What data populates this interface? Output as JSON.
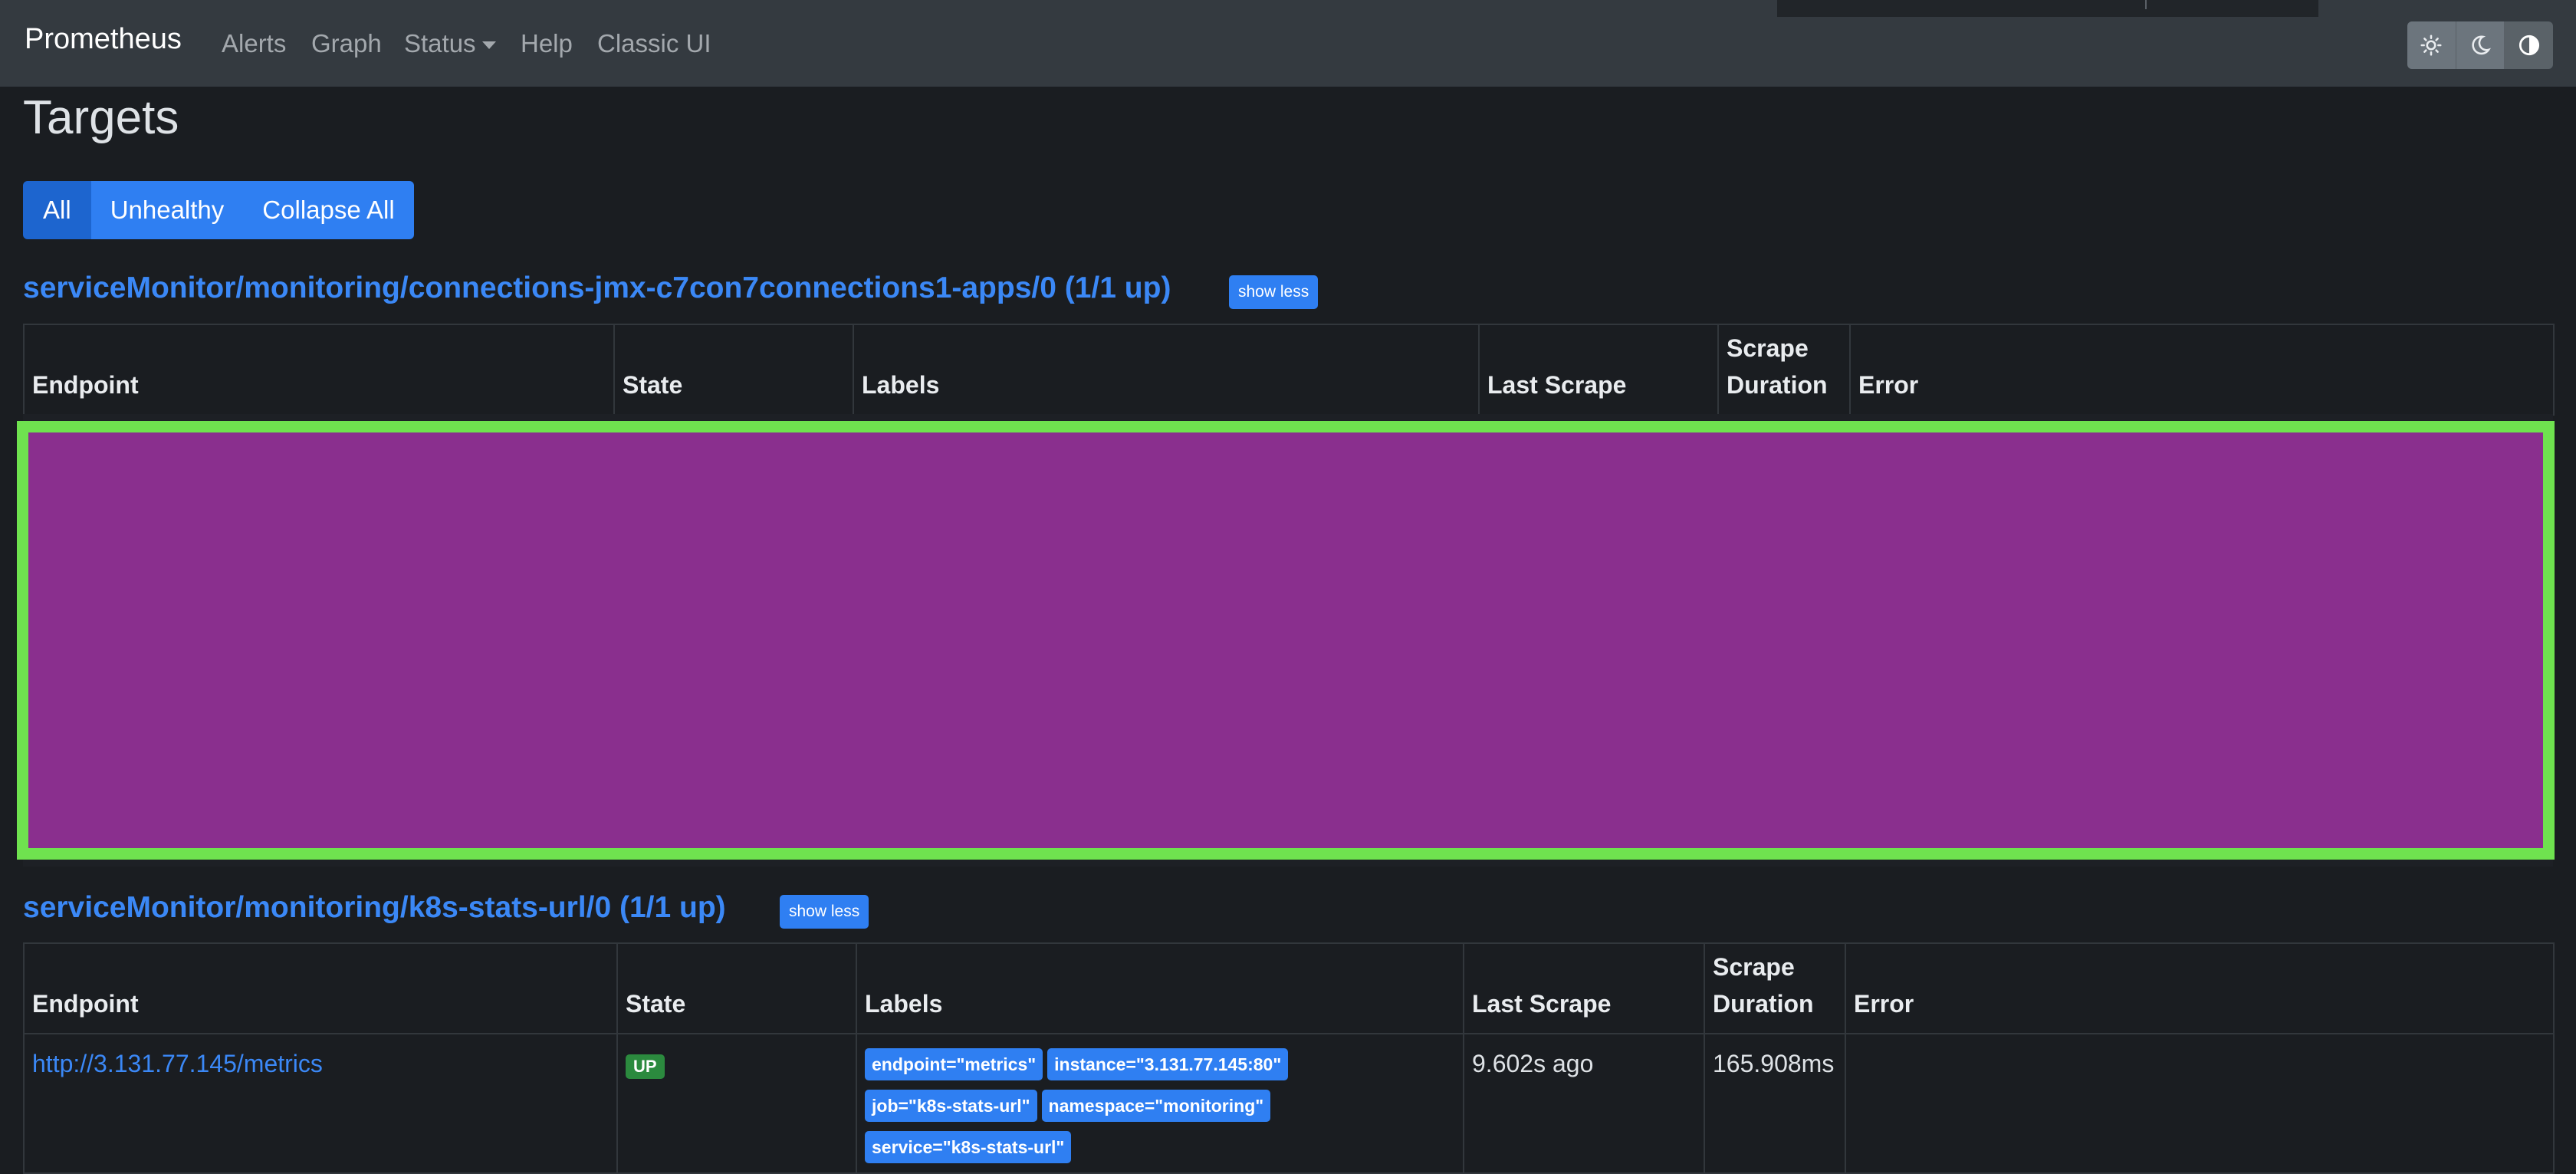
{
  "navbar": {
    "brand": "Prometheus",
    "links": [
      "Alerts",
      "Graph",
      "Status",
      "Help",
      "Classic UI"
    ],
    "theme_icons": [
      "sun-icon",
      "moon-icon",
      "contrast-icon"
    ]
  },
  "page": {
    "title": "Targets",
    "filters": [
      "All",
      "Unhealthy",
      "Collapse All"
    ]
  },
  "table_headers": [
    "Endpoint",
    "State",
    "Labels",
    "Last Scrape",
    "Scrape Duration",
    "Error"
  ],
  "pools": [
    {
      "title": "serviceMonitor/monitoring/connections-jmx-c7con7connections1-apps/0 (1/1 up)",
      "toggle": "show less"
    },
    {
      "title": "serviceMonitor/monitoring/k8s-stats-url/0 (1/1 up)",
      "toggle": "show less",
      "rows": [
        {
          "endpoint": "http://3.131.77.145/metrics",
          "state": "UP",
          "labels": [
            "endpoint=\"metrics\"",
            "instance=\"3.131.77.145:80\"",
            "job=\"k8s-stats-url\"",
            "namespace=\"monitoring\"",
            "service=\"k8s-stats-url\""
          ],
          "last_scrape": "9.602s ago",
          "scrape_duration": "165.908ms",
          "error": ""
        }
      ]
    }
  ],
  "colors": {
    "navbar": "#343a40",
    "background": "#1a1d21",
    "primary": "#2f7ff2",
    "link": "#3b88f6",
    "up_badge": "#2b8a3e",
    "redaction_fill": "#8a2f8e",
    "redaction_border": "#6fe24f"
  }
}
